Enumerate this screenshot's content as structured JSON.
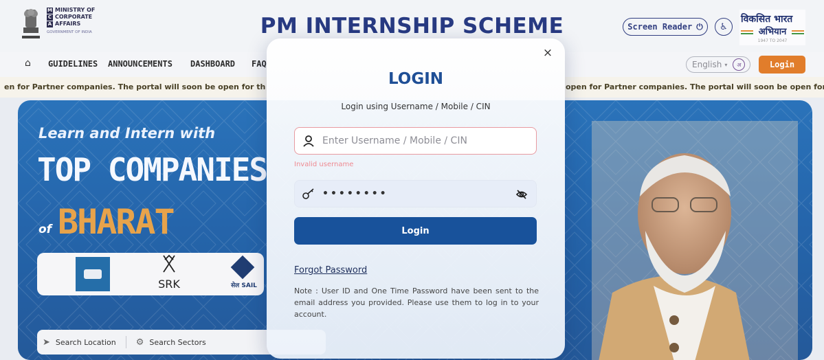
{
  "header": {
    "ministry_lines": [
      "MINISTRY OF",
      "CORPORATE",
      "AFFAIRS"
    ],
    "ministry_initials": [
      "M",
      "C",
      "A"
    ],
    "ministry_sub": "GOVERNMENT OF INDIA",
    "site_title": "PM INTERNSHIP SCHEME",
    "screen_reader_label": "Screen Reader",
    "viksit_line1": "विकसित भारत",
    "viksit_line2": "अभियान",
    "viksit_line3": "1947 TO 2047"
  },
  "nav": {
    "items": [
      "GUIDELINES",
      "ANNOUNCEMENTS",
      "DASHBOARD",
      "FAQ"
    ],
    "language": "English",
    "language_badge": "अ",
    "login_label": "Login"
  },
  "ticker": {
    "left_text": "en for Partner companies. The portal will soon be open for th",
    "right_text": "open for Partner companies. The portal will soon be open for t"
  },
  "hero": {
    "learn": "Learn and Intern with",
    "headline": "TOP COMPANIES",
    "of": "of",
    "bharat": "BHARAT",
    "srk": "SRK",
    "sail": "सेल SAIL",
    "search_location": "Search Location",
    "search_sectors": "Search Sectors"
  },
  "modal": {
    "title": "LOGIN",
    "subtitle": "Login using Username / Mobile / CIN",
    "username_placeholder": "Enter Username / Mobile / CIN",
    "username_value": "",
    "error": "Invalid username",
    "password_value": "••••••••",
    "login_button": "Login",
    "forgot_password": "Forgot Password",
    "note": "Note : User ID and One Time Password have been sent to the email address you provided. Please use them to log in to your account.",
    "close_icon": "×"
  },
  "colors": {
    "brand_blue": "#18529b",
    "title_blue": "#243a8f",
    "accent_orange": "#f07a1a",
    "error_red": "#ef8a92"
  }
}
